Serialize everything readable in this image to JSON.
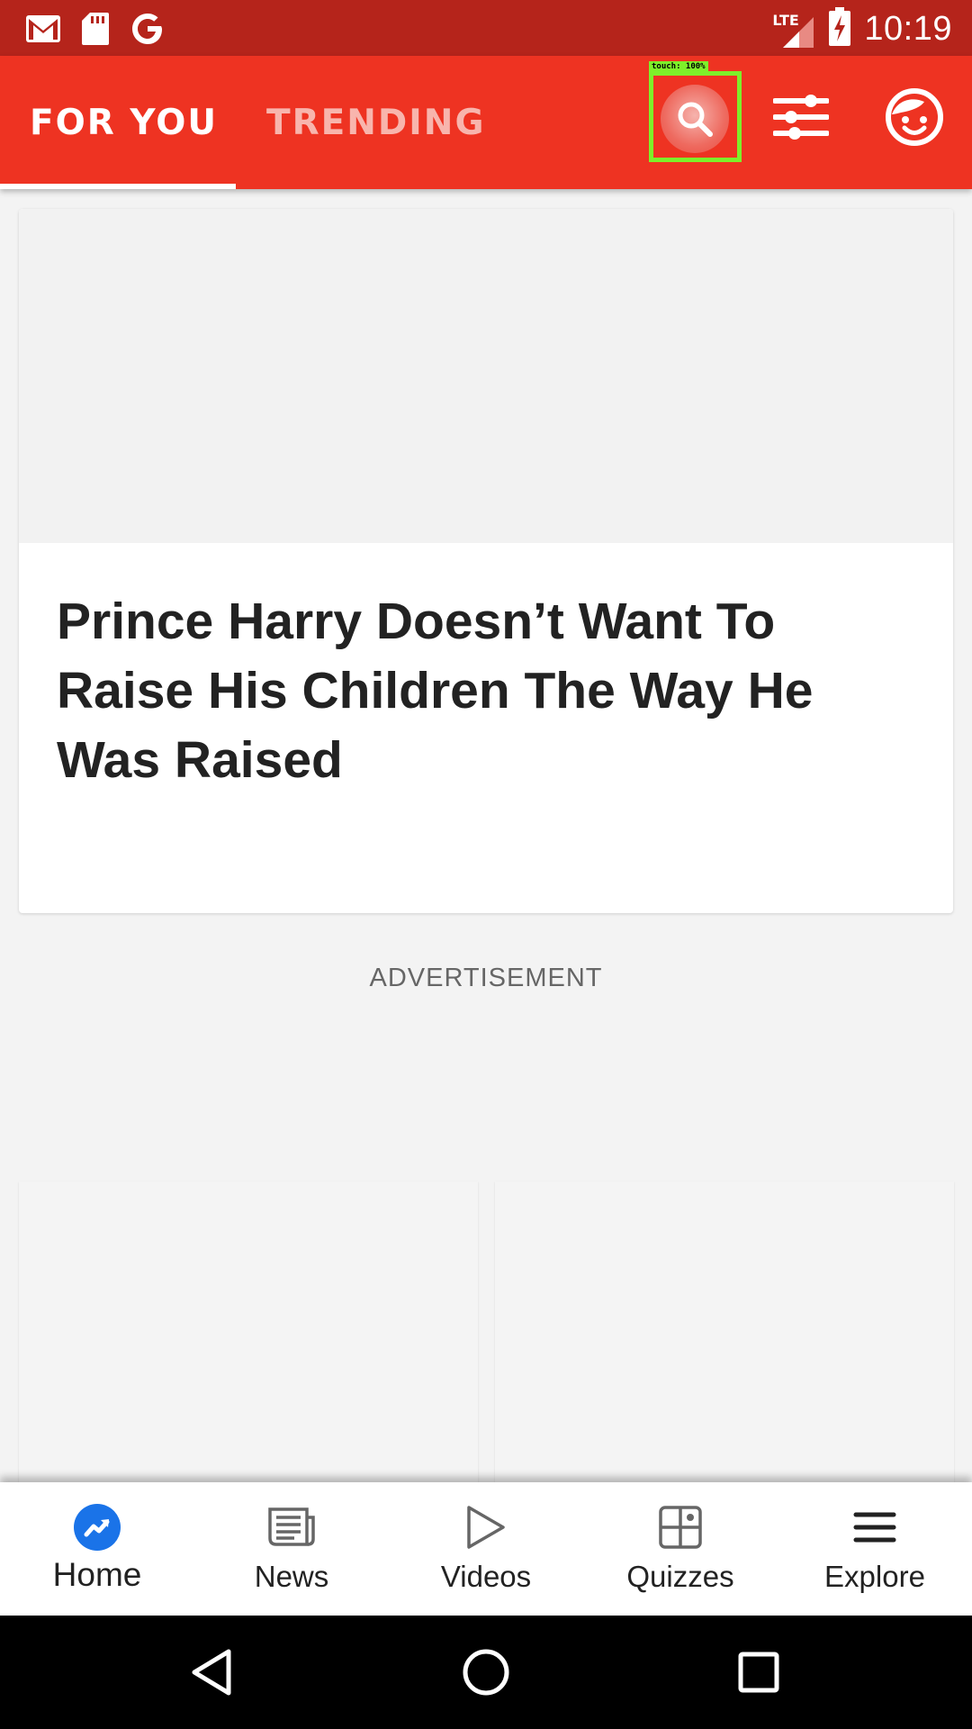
{
  "status_bar": {
    "time": "10:19",
    "network": "LTE",
    "icons": [
      "gmail-icon",
      "sd-card-icon",
      "google-icon",
      "signal-icon",
      "battery-charging-icon"
    ]
  },
  "header": {
    "tabs": [
      {
        "label": "FOR YOU",
        "active": true
      },
      {
        "label": "TRENDING",
        "active": false
      }
    ],
    "actions": [
      "search-icon",
      "filter-sliders-icon",
      "profile-face-icon"
    ],
    "touch_overlay": "touch: 100%",
    "colors": {
      "header": "#ee3322",
      "status_bar": "#b5241b",
      "touch_box": "#7ef02a"
    }
  },
  "feed": {
    "featured_title": "Prince Harry Doesn’t Want To Raise His Children The Way He Was Raised",
    "ad_label": "ADVERTISEMENT"
  },
  "bottom_nav": {
    "items": [
      {
        "label": "Home",
        "icon": "trending-home-icon",
        "active": true
      },
      {
        "label": "News",
        "icon": "newspaper-icon",
        "active": false
      },
      {
        "label": "Videos",
        "icon": "play-icon",
        "active": false
      },
      {
        "label": "Quizzes",
        "icon": "grid-icon",
        "active": false
      },
      {
        "label": "Explore",
        "icon": "menu-icon",
        "active": false
      }
    ],
    "active_color": "#1a73e8"
  },
  "system_nav": [
    "back-icon",
    "home-circle-icon",
    "recents-icon"
  ]
}
